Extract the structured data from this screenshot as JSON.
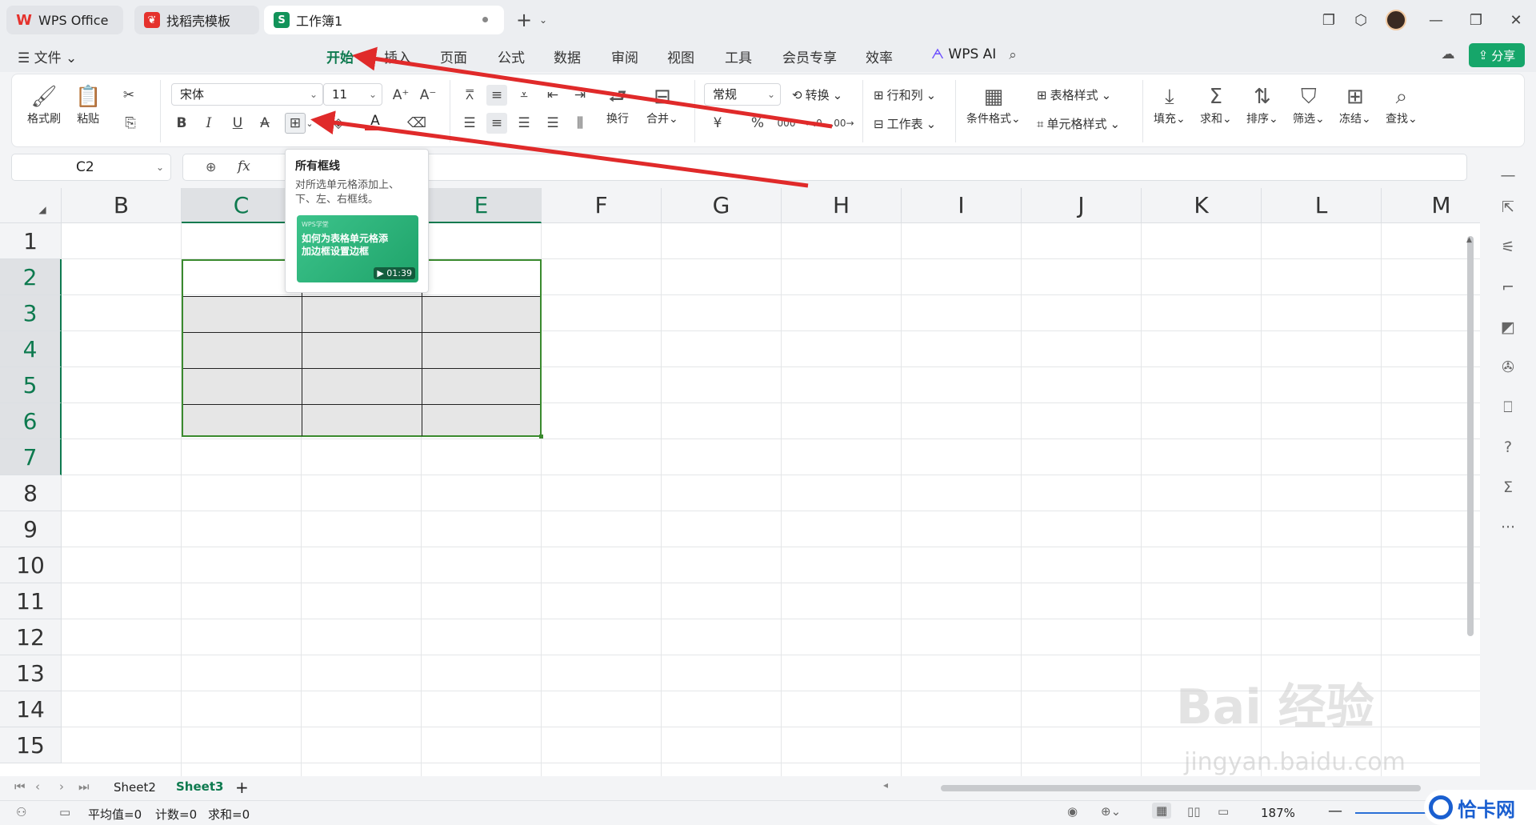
{
  "tabs": [
    {
      "label": "WPS Office"
    },
    {
      "label": "找稻壳模板"
    },
    {
      "label": "工作簿1"
    }
  ],
  "menu": {
    "file": "文件",
    "items": [
      "开始",
      "插入",
      "页面",
      "公式",
      "数据",
      "审阅",
      "视图",
      "工具",
      "会员专享",
      "效率"
    ],
    "wps_ai": "WPS AI",
    "share": "分享"
  },
  "ribbon": {
    "format_painter": "格式刷",
    "paste": "粘贴",
    "font_name": "宋体",
    "font_size": "11",
    "wrap": "换行",
    "merge": "合并",
    "number_format": "常规",
    "convert": "转换",
    "rows_cols": "行和列",
    "worksheet": "工作表",
    "cond_format": "条件格式",
    "table_style": "表格样式",
    "cell_style": "单元格样式",
    "fill": "填充",
    "sum": "求和",
    "sort": "排序",
    "filter": "筛选",
    "freeze": "冻结",
    "find": "查找",
    "currency": "¥",
    "percent": "%",
    "thousands": "000"
  },
  "formula_bar": {
    "cell_ref": "C2",
    "fx": "fx",
    "value": ""
  },
  "grid": {
    "columns": [
      "B",
      "C",
      "D",
      "E",
      "F",
      "G",
      "H",
      "I",
      "J",
      "K",
      "L",
      "M"
    ],
    "rows": [
      "1",
      "2",
      "3",
      "4",
      "5",
      "6",
      "7",
      "8",
      "9",
      "10",
      "11",
      "12",
      "13",
      "14",
      "15"
    ],
    "selected_range": "C2:E7"
  },
  "tooltip": {
    "title": "所有框线",
    "desc": "对所选单元格添加上、下、左、右框线。",
    "card_brand": "WPS学堂",
    "card_title": "如何为表格单元格添加边框设置边框",
    "card_duration": "01:39"
  },
  "sheets": {
    "tabs": [
      "Sheet2",
      "Sheet3"
    ],
    "active": "Sheet3"
  },
  "status": {
    "avg": "平均值=0",
    "count": "计数=0",
    "sum": "求和=0",
    "zoom": "187%"
  },
  "watermark": {
    "text": "Bai 经验",
    "url": "jingyan.baidu.com",
    "corner": "恰卡网"
  },
  "colors": {
    "accent": "#0e7a4f",
    "share": "#16a66a",
    "arrow": "#e02a2a",
    "selection_fill": "#e6e6e6"
  }
}
